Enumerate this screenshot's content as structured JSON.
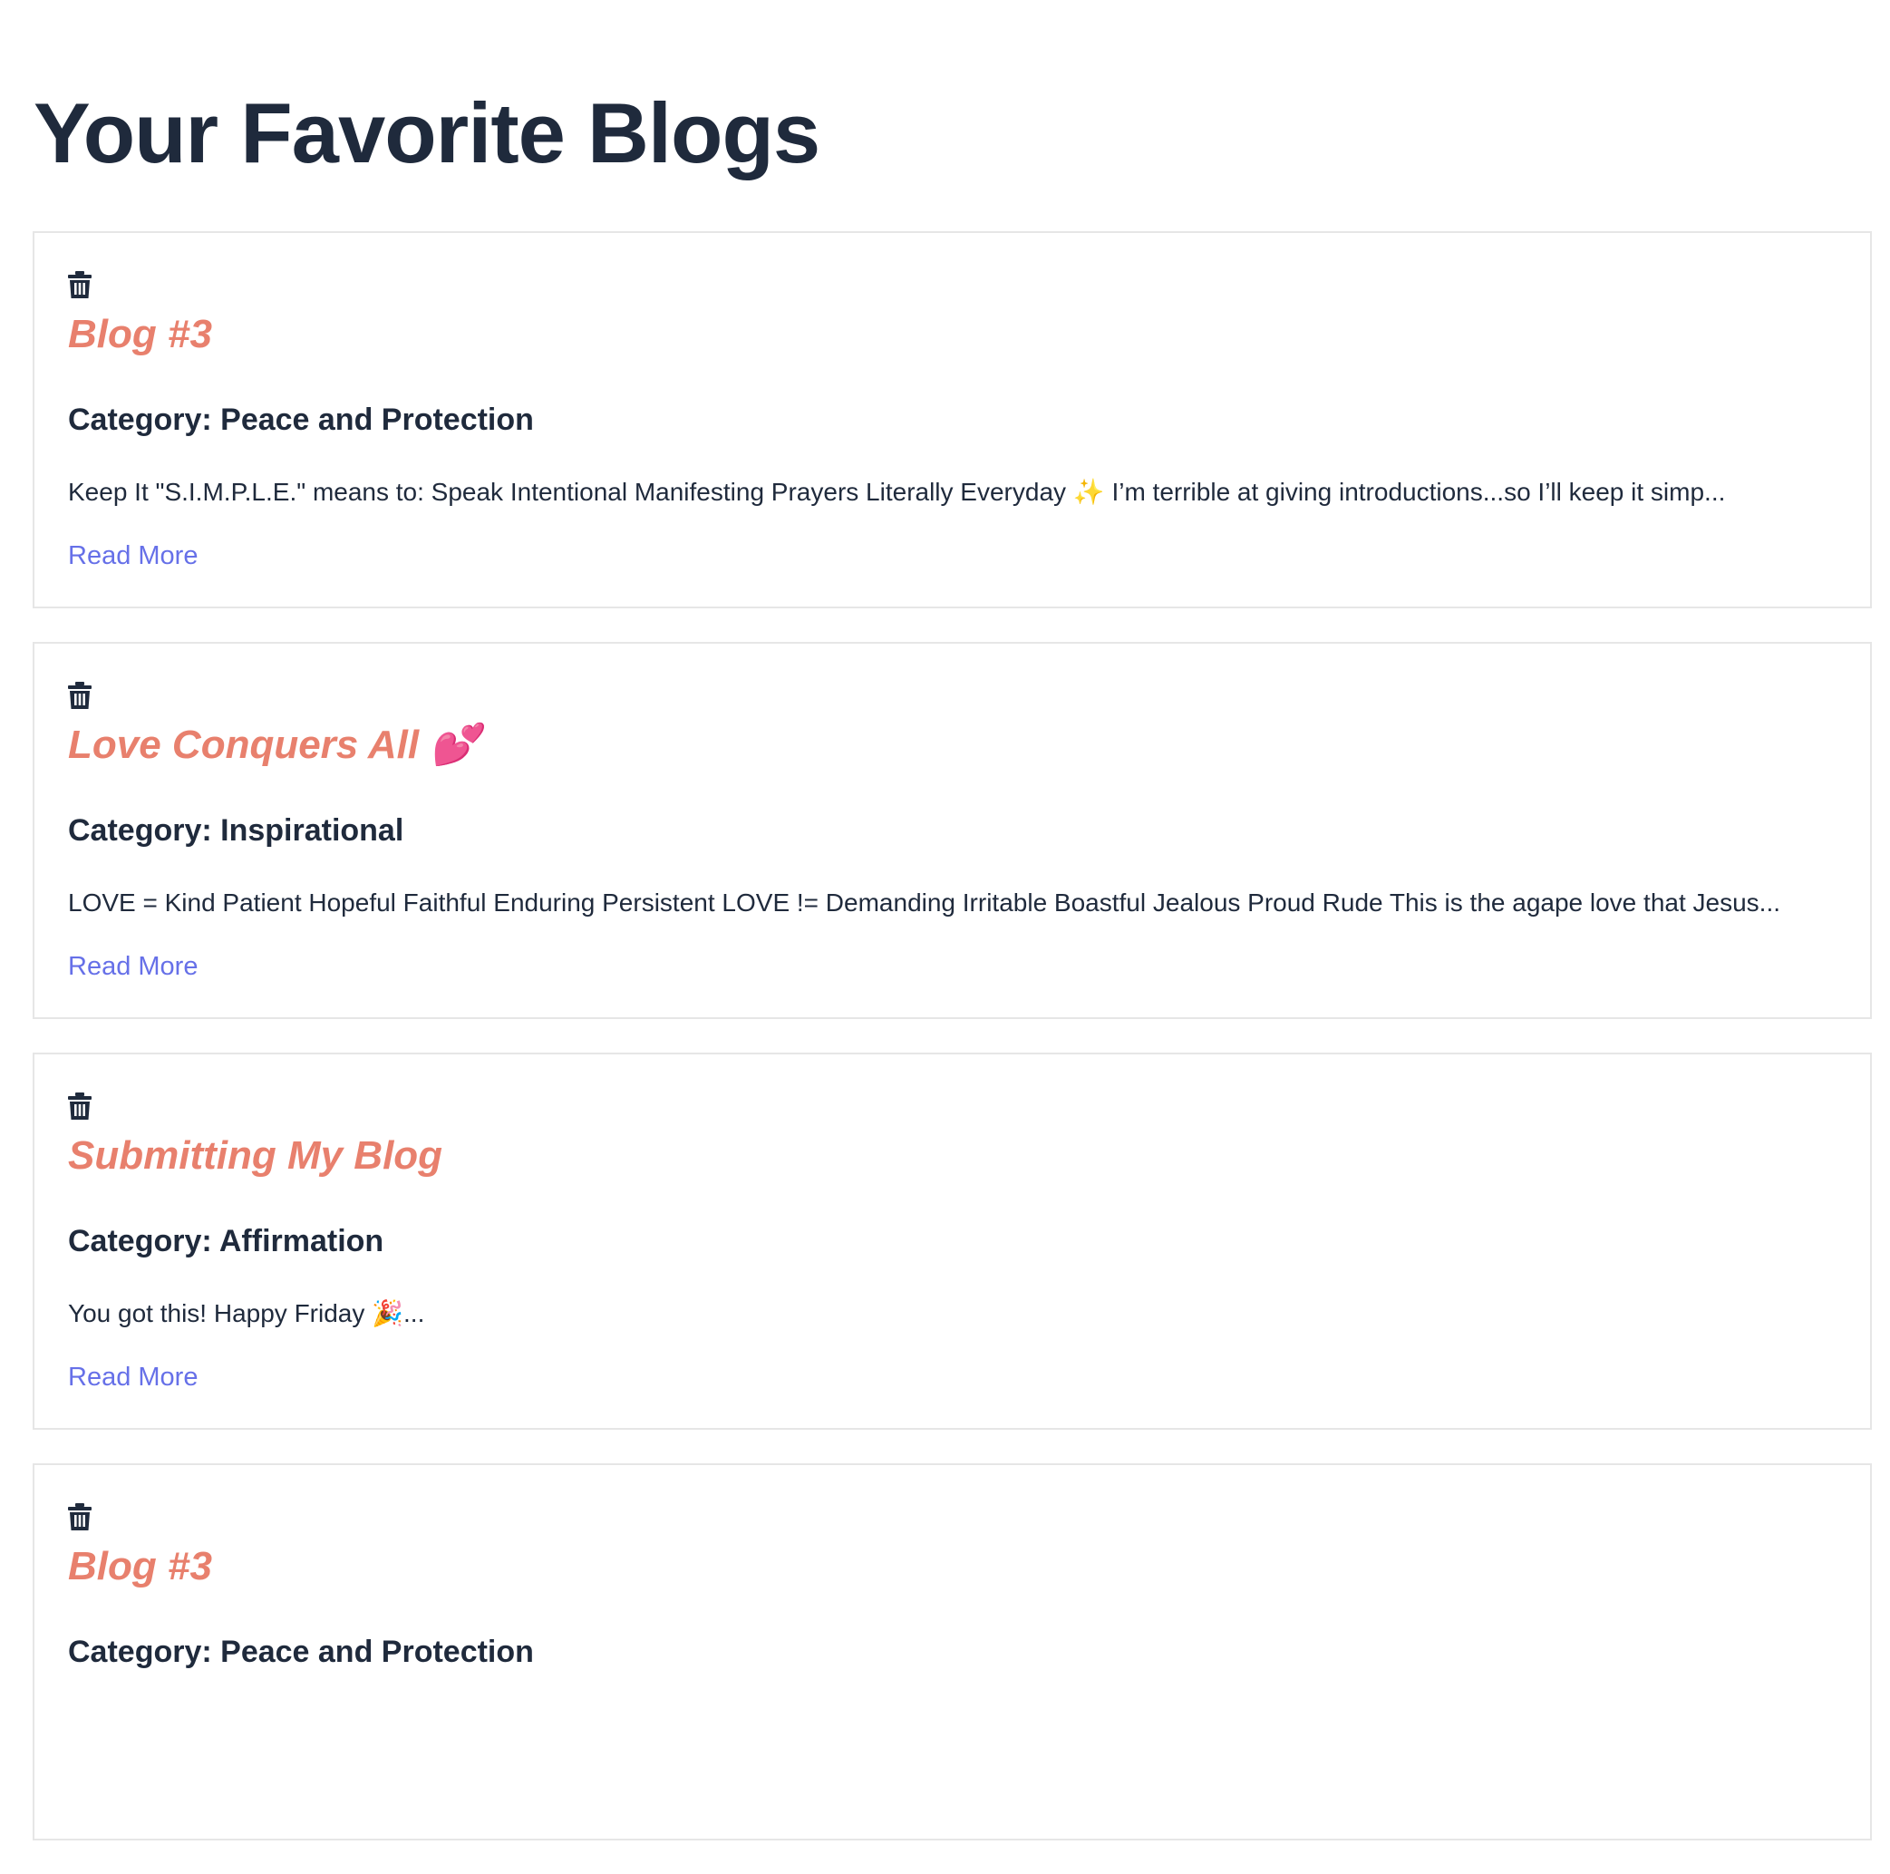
{
  "page": {
    "title": "Your Favorite Blogs"
  },
  "colors": {
    "heading": "#1f2a3c",
    "blog_title": "#e8806d",
    "link": "#6670e8",
    "card_border": "#e6e6e6"
  },
  "blogs": [
    {
      "delete_icon": "trash-icon",
      "title": "Blog #3",
      "category": "Category: Peace and Protection",
      "excerpt": "Keep It \"S.I.M.P.L.E.\" means to: Speak Intentional Manifesting Prayers Literally Everyday ✨ I’m terrible at giving introductions...so I’ll keep it simp...",
      "read_more": "Read More"
    },
    {
      "delete_icon": "trash-icon",
      "title": "Love Conquers All 💕",
      "category": "Category: Inspirational",
      "excerpt": "LOVE = Kind Patient Hopeful Faithful Enduring Persistent LOVE != Demanding Irritable Boastful Jealous Proud Rude This is the agape love that Jesus...",
      "read_more": "Read More"
    },
    {
      "delete_icon": "trash-icon",
      "title": "Submitting My Blog",
      "category": "Category: Affirmation",
      "excerpt": "You got this! Happy Friday 🎉...",
      "read_more": "Read More"
    },
    {
      "delete_icon": "trash-icon",
      "title": "Blog #3",
      "category": "Category: Peace and Protection",
      "excerpt": "",
      "read_more": ""
    }
  ]
}
